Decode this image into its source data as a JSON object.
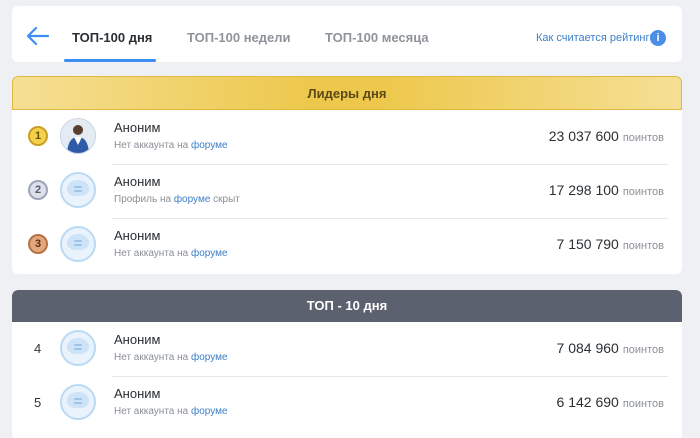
{
  "tabs": [
    {
      "label": "ТОП-100 дня",
      "active": true
    },
    {
      "label": "ТОП-100 недели",
      "active": false
    },
    {
      "label": "ТОП-100 месяца",
      "active": false
    }
  ],
  "help_link": "Как считается рейтинг?",
  "info_icon": "i",
  "leaders": {
    "title": "Лидеры дня",
    "rows": [
      {
        "rank": "1",
        "medal": "gold",
        "avatar": "photo",
        "name": "Аноним",
        "sub_before": "Нет аккаунта на",
        "sub_link": "форуме",
        "sub_after": "",
        "points": "23 037 600",
        "unit": "поинтов"
      },
      {
        "rank": "2",
        "medal": "silver",
        "avatar": "default",
        "name": "Аноним",
        "sub_before": "Профиль на",
        "sub_link": "форуме",
        "sub_after": "скрыт",
        "points": "17 298 100",
        "unit": "поинтов"
      },
      {
        "rank": "3",
        "medal": "bronze",
        "avatar": "default",
        "name": "Аноним",
        "sub_before": "Нет аккаунта на",
        "sub_link": "форуме",
        "sub_after": "",
        "points": "7 150 790",
        "unit": "поинтов"
      }
    ]
  },
  "top10": {
    "title": "ТОП - 10 дня",
    "rows": [
      {
        "rank": "4",
        "avatar": "default",
        "name": "Аноним",
        "sub_before": "Нет аккаунта на",
        "sub_link": "форуме",
        "sub_after": "",
        "points": "7 084 960",
        "unit": "поинтов"
      },
      {
        "rank": "5",
        "avatar": "default",
        "name": "Аноним",
        "sub_before": "Нет аккаунта на",
        "sub_link": "форуме",
        "sub_after": "",
        "points": "6 142 690",
        "unit": "поинтов"
      }
    ]
  },
  "colors": {
    "accent": "#3d8ef0",
    "link": "#3d7fc8",
    "gold_band": "#edc84c",
    "dark_band": "#5c616f"
  }
}
